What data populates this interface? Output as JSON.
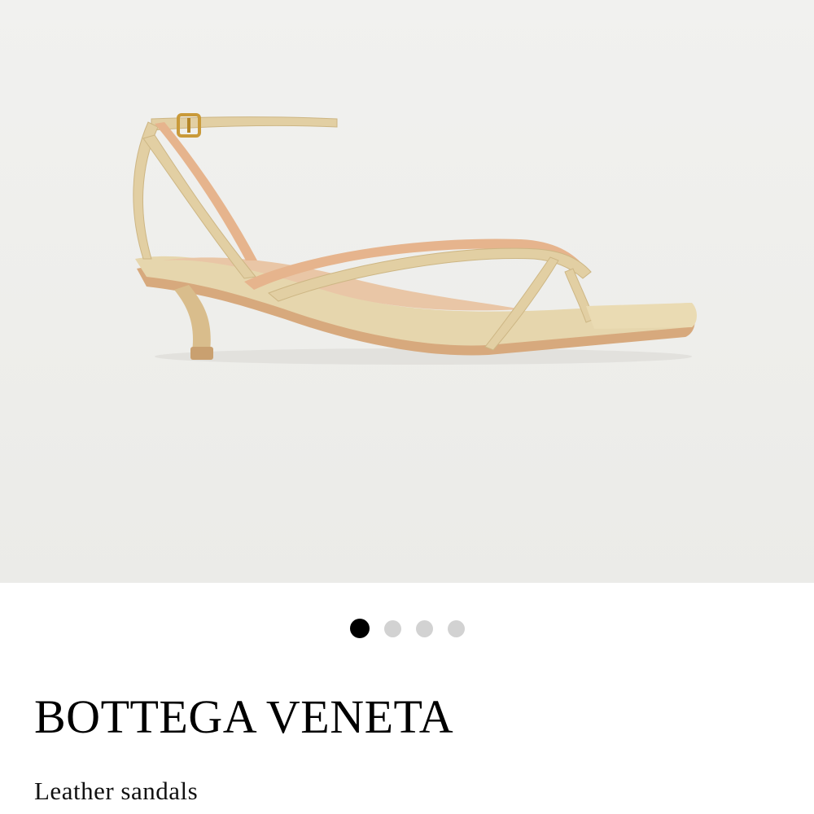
{
  "product": {
    "brand": "BOTTEGA VENETA",
    "name": "Leather sandals"
  },
  "gallery": {
    "image_alt": "beige leather strappy kitten-heel sandal",
    "total_images": 4,
    "active_index": 0
  },
  "colors": {
    "leather": "#e2cfa3",
    "leather_shadow": "#cdb684",
    "lining": "#d9a27a",
    "buckle": "#c99a3a",
    "dot_active": "#000000",
    "dot_inactive": "#d2d2d2"
  }
}
